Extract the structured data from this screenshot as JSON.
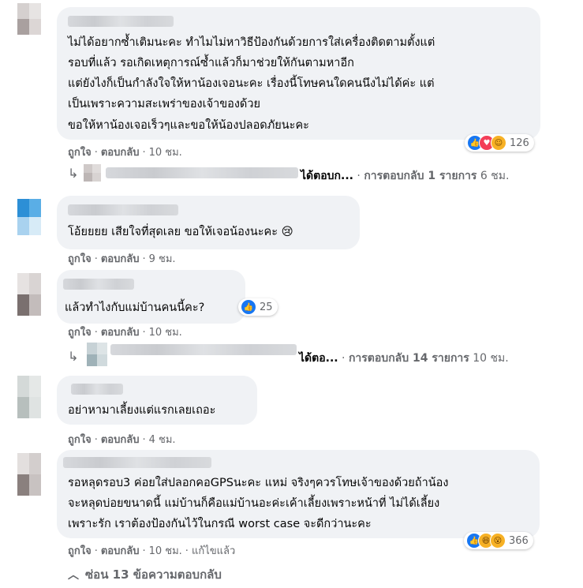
{
  "comments": [
    {
      "text": "ไม่ได้อยากซ้ำเติมนะคะ ทำไมไม่หาวิธีป้องกันด้วยการใส่เครื่องติดตามตั้งแต่\nรอบที่แล้ว รอเกิดเหตุการณ์ซ้ำแล้วก็มาช่วยให้กันตามหาอีก\nแต่ยังไงก็เป็นกำลังใจให้หาน้องเจอนะคะ เรื่องนี้โทษคนใดคนนึงไม่ได้ค่ะ แต่\nเป็นเพราะความสะเพร่าของเจ้าของด้วย",
      "text2": "ขอให้หาน้องเจอเร็วๆและขอให้น้องปลอดภัยนะคะ",
      "like": "ถูกใจ",
      "reply": "ตอบกลับ",
      "time": "10 ชม.",
      "reaction_count": "126",
      "reactions": [
        "like-icon",
        "love-icon",
        "care-icon"
      ],
      "reply_summary": {
        "snippet": "ได้ตอบก...",
        "label": "การตอบกลับ 1 รายการ",
        "time": "6 ชม."
      }
    },
    {
      "text": "โอ้ยยยย เสียใจที่สุดเลย ขอให้เจอน้องนะคะ 😢",
      "like": "ถูกใจ",
      "reply": "ตอบกลับ",
      "time": "9 ชม."
    },
    {
      "text": "แล้วทำไงกับแม่บ้านคนนี้คะ?",
      "like": "ถูกใจ",
      "reply": "ตอบกลับ",
      "time": "10 ชม.",
      "reaction_count": "25",
      "reactions": [
        "like-icon"
      ],
      "reply_summary": {
        "snippet": "ได้ตอ...",
        "label": "การตอบกลับ 14 รายการ",
        "time": "10 ชม."
      }
    },
    {
      "text": "อย่าหามาเลี้ยงแต่แรกเลยเถอะ",
      "like": "ถูกใจ",
      "reply": "ตอบกลับ",
      "time": "4 ชม."
    },
    {
      "text": "รอหลุดรอบ3 ค่อยใส่ปลอกคอGPSนะคะ แหม่ จริงๆควรโทษเจ้าของด้วยถ้าน้อง\nจะหลุดบ่อยขนาดนี้ แม่บ้านก็คือแม่บ้านอะค่ะเค้าเลี้ยงเพราะหน้าที่ ไม่ได้เลี้ยง\nเพราะรัก เราต้องป้องกันไว้ในกรณี worst case จะดีกว่านะคะ",
      "like": "ถูกใจ",
      "reply": "ตอบกลับ",
      "time": "10 ชม.",
      "edited": "แก้ไขแล้ว",
      "reaction_count": "366",
      "reactions": [
        "like-icon",
        "haha-icon",
        "wow-icon"
      ]
    }
  ],
  "hide_replies": "ซ่อน 13 ข้อความตอบกลับ",
  "colors": {
    "bubble": "#f0f2f5",
    "secondary_text": "#65676b",
    "like_blue": "#1877f2"
  }
}
